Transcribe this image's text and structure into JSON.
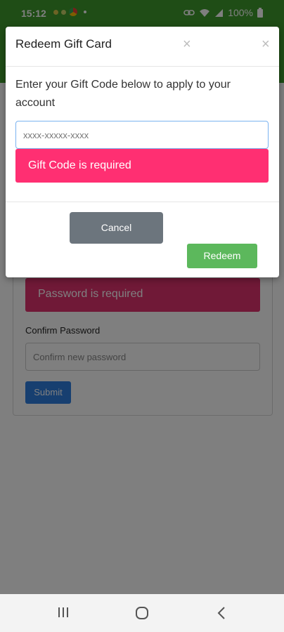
{
  "status_bar": {
    "time": "15:12",
    "battery": "100%"
  },
  "background_form": {
    "password_error": "Password is required",
    "confirm_label": "Confirm Password",
    "confirm_placeholder": "Confirm new password",
    "submit_label": "Submit"
  },
  "modal": {
    "title": "Redeem Gift Card",
    "close_glyph": "×",
    "instructions": "Enter your Gift Code below to apply to your account",
    "gift_code_placeholder": "xxxx-xxxxx-xxxx",
    "gift_code_error": "Gift Code is required",
    "cancel_label": "Cancel",
    "redeem_label": "Redeem"
  },
  "colors": {
    "brand_green": "#3f9b2c",
    "error_pink": "#ff2f72",
    "cancel_gray": "#6c757d",
    "redeem_green": "#5cb85c",
    "submit_blue": "#2e7fe0"
  },
  "icons": {
    "nav_recents": "recents-icon",
    "nav_home": "home-icon",
    "nav_back": "back-icon",
    "status_wifi": "wifi-icon",
    "status_signal": "signal-icon",
    "status_battery": "battery-icon",
    "status_link": "link-icon"
  }
}
